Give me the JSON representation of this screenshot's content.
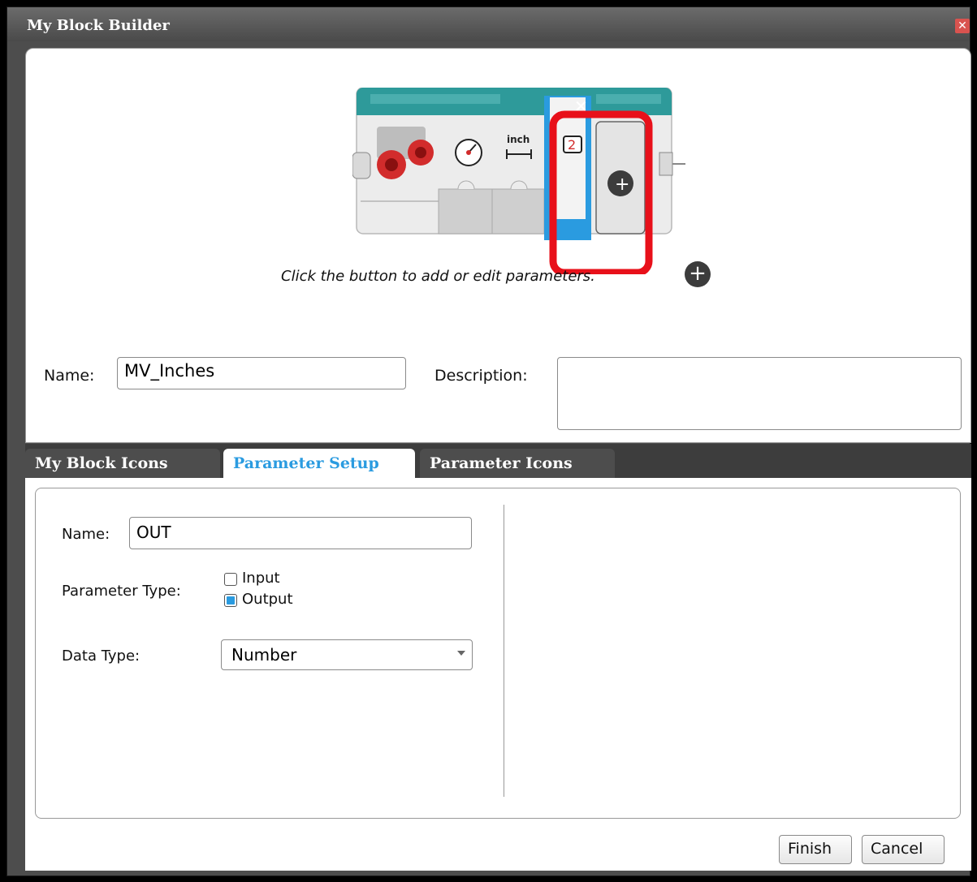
{
  "window": {
    "title": "My Block Builder",
    "close_glyph": "✕"
  },
  "block": {
    "unit_label": "inch",
    "param_value": "2",
    "remove_glyph": "✕",
    "add_glyph": "+"
  },
  "top": {
    "hint": "Click the button to add or edit parameters.",
    "hint_glyph": "+",
    "name_label": "Name:",
    "name_value": "MV_Inches",
    "description_label": "Description:",
    "description_value": ""
  },
  "tabs": [
    {
      "label": "My Block Icons",
      "active": false
    },
    {
      "label": "Parameter Setup",
      "active": true
    },
    {
      "label": "Parameter Icons",
      "active": false
    }
  ],
  "parameter": {
    "name_label": "Name:",
    "name_value": "OUT",
    "type_label": "Parameter Type:",
    "type_options": [
      {
        "label": "Input",
        "checked": false
      },
      {
        "label": "Output",
        "checked": true
      }
    ],
    "data_type_label": "Data Type:",
    "data_type_value": "Number"
  },
  "buttons": {
    "finish": "Finish",
    "cancel": "Cancel"
  },
  "colors": {
    "accent": "#2a9be0",
    "highlight": "#e8101a",
    "block_teal": "#2e9a9a"
  }
}
